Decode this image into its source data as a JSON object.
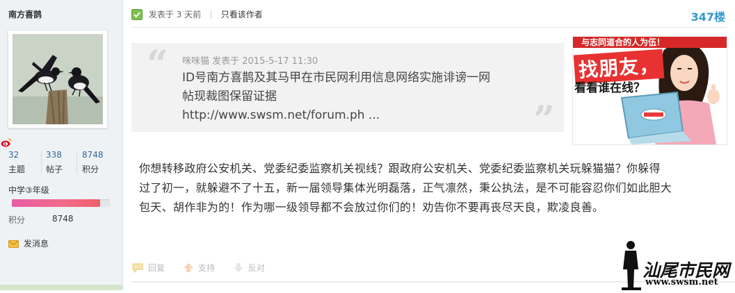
{
  "user": {
    "name": "南方喜鹊",
    "stats": [
      {
        "value": "32",
        "label": "主题"
      },
      {
        "value": "338",
        "label": "帖子"
      },
      {
        "value": "8748",
        "label": "积分"
      }
    ],
    "level": "中学③年级",
    "level_progress": 0.9,
    "points_label": "积分",
    "points_value": "8748",
    "pm_label": "发消息"
  },
  "post": {
    "posted_text": "发表于 3 天前",
    "author_only": "只看该作者",
    "floor": "347楼",
    "quote": {
      "author_line": "咪咪猫 发表于 2015-5-17 11:30",
      "lines": [
        "ID号南方喜鹊及其马甲在市民网利用信息网络实施诽谤一网",
        "帖现裁图保留证据",
        "http://www.swsm.net/forum.ph ..."
      ]
    },
    "body_lines": [
      "你想转移政府公安机关、党委纪委监察机关视线？跟政府公安机关、党委纪委监察机关玩躲猫猫？你躲得",
      "过了初一，就躲避不了十五，新一届领导集体光明磊落，正气凛然，秉公执法，是不可能容忍你们如此胆大",
      "包天、胡作非为的！作为哪一级领导都不会放过你们的！劝告你不要再丧尽天良，欺凌良善。"
    ],
    "actions": {
      "reply": "回复",
      "support": "支持",
      "oppose": "反对"
    }
  },
  "ad": {
    "tagline": "与志同道合的人为伍！",
    "title": "找朋友，",
    "subtitle": "看看谁在线？"
  },
  "watermark": {
    "text": "汕尾市民网",
    "url": "www.swsm.net"
  }
}
